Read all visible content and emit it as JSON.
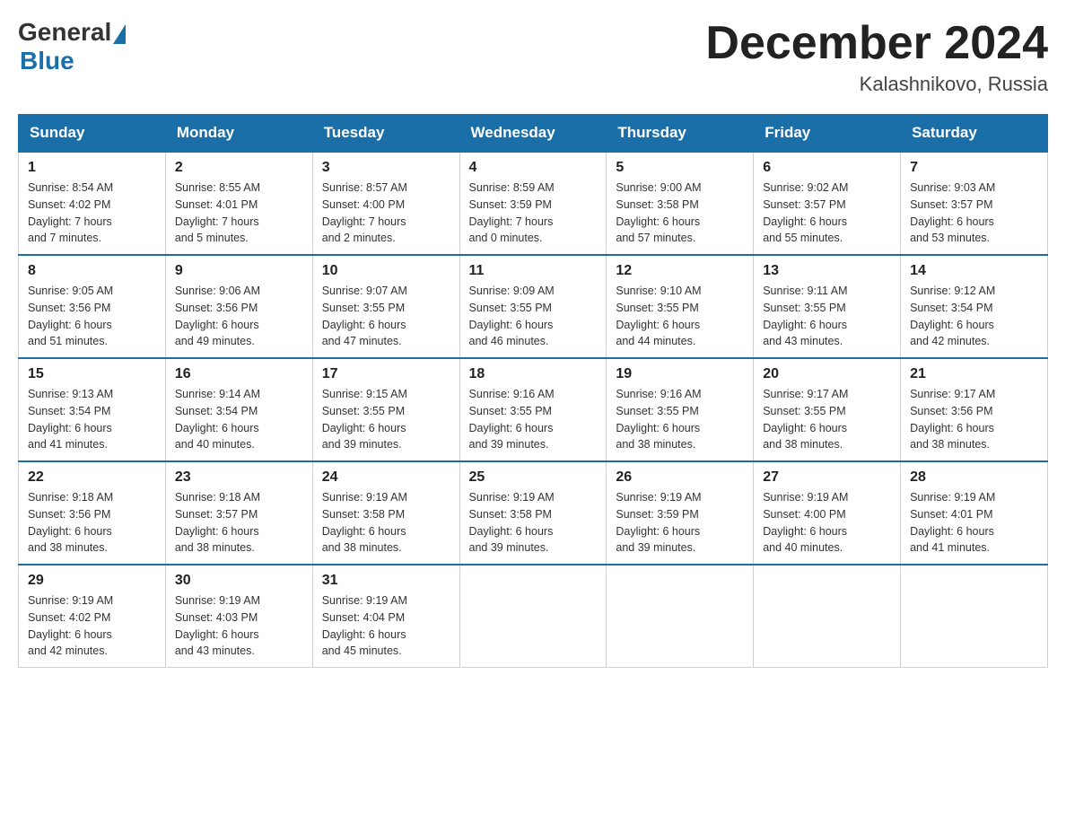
{
  "logo": {
    "general": "General",
    "triangle": "",
    "blue": "Blue"
  },
  "title": "December 2024",
  "location": "Kalashnikovo, Russia",
  "headers": [
    "Sunday",
    "Monday",
    "Tuesday",
    "Wednesday",
    "Thursday",
    "Friday",
    "Saturday"
  ],
  "weeks": [
    [
      {
        "day": "1",
        "info": "Sunrise: 8:54 AM\nSunset: 4:02 PM\nDaylight: 7 hours\nand 7 minutes."
      },
      {
        "day": "2",
        "info": "Sunrise: 8:55 AM\nSunset: 4:01 PM\nDaylight: 7 hours\nand 5 minutes."
      },
      {
        "day": "3",
        "info": "Sunrise: 8:57 AM\nSunset: 4:00 PM\nDaylight: 7 hours\nand 2 minutes."
      },
      {
        "day": "4",
        "info": "Sunrise: 8:59 AM\nSunset: 3:59 PM\nDaylight: 7 hours\nand 0 minutes."
      },
      {
        "day": "5",
        "info": "Sunrise: 9:00 AM\nSunset: 3:58 PM\nDaylight: 6 hours\nand 57 minutes."
      },
      {
        "day": "6",
        "info": "Sunrise: 9:02 AM\nSunset: 3:57 PM\nDaylight: 6 hours\nand 55 minutes."
      },
      {
        "day": "7",
        "info": "Sunrise: 9:03 AM\nSunset: 3:57 PM\nDaylight: 6 hours\nand 53 minutes."
      }
    ],
    [
      {
        "day": "8",
        "info": "Sunrise: 9:05 AM\nSunset: 3:56 PM\nDaylight: 6 hours\nand 51 minutes."
      },
      {
        "day": "9",
        "info": "Sunrise: 9:06 AM\nSunset: 3:56 PM\nDaylight: 6 hours\nand 49 minutes."
      },
      {
        "day": "10",
        "info": "Sunrise: 9:07 AM\nSunset: 3:55 PM\nDaylight: 6 hours\nand 47 minutes."
      },
      {
        "day": "11",
        "info": "Sunrise: 9:09 AM\nSunset: 3:55 PM\nDaylight: 6 hours\nand 46 minutes."
      },
      {
        "day": "12",
        "info": "Sunrise: 9:10 AM\nSunset: 3:55 PM\nDaylight: 6 hours\nand 44 minutes."
      },
      {
        "day": "13",
        "info": "Sunrise: 9:11 AM\nSunset: 3:55 PM\nDaylight: 6 hours\nand 43 minutes."
      },
      {
        "day": "14",
        "info": "Sunrise: 9:12 AM\nSunset: 3:54 PM\nDaylight: 6 hours\nand 42 minutes."
      }
    ],
    [
      {
        "day": "15",
        "info": "Sunrise: 9:13 AM\nSunset: 3:54 PM\nDaylight: 6 hours\nand 41 minutes."
      },
      {
        "day": "16",
        "info": "Sunrise: 9:14 AM\nSunset: 3:54 PM\nDaylight: 6 hours\nand 40 minutes."
      },
      {
        "day": "17",
        "info": "Sunrise: 9:15 AM\nSunset: 3:55 PM\nDaylight: 6 hours\nand 39 minutes."
      },
      {
        "day": "18",
        "info": "Sunrise: 9:16 AM\nSunset: 3:55 PM\nDaylight: 6 hours\nand 39 minutes."
      },
      {
        "day": "19",
        "info": "Sunrise: 9:16 AM\nSunset: 3:55 PM\nDaylight: 6 hours\nand 38 minutes."
      },
      {
        "day": "20",
        "info": "Sunrise: 9:17 AM\nSunset: 3:55 PM\nDaylight: 6 hours\nand 38 minutes."
      },
      {
        "day": "21",
        "info": "Sunrise: 9:17 AM\nSunset: 3:56 PM\nDaylight: 6 hours\nand 38 minutes."
      }
    ],
    [
      {
        "day": "22",
        "info": "Sunrise: 9:18 AM\nSunset: 3:56 PM\nDaylight: 6 hours\nand 38 minutes."
      },
      {
        "day": "23",
        "info": "Sunrise: 9:18 AM\nSunset: 3:57 PM\nDaylight: 6 hours\nand 38 minutes."
      },
      {
        "day": "24",
        "info": "Sunrise: 9:19 AM\nSunset: 3:58 PM\nDaylight: 6 hours\nand 38 minutes."
      },
      {
        "day": "25",
        "info": "Sunrise: 9:19 AM\nSunset: 3:58 PM\nDaylight: 6 hours\nand 39 minutes."
      },
      {
        "day": "26",
        "info": "Sunrise: 9:19 AM\nSunset: 3:59 PM\nDaylight: 6 hours\nand 39 minutes."
      },
      {
        "day": "27",
        "info": "Sunrise: 9:19 AM\nSunset: 4:00 PM\nDaylight: 6 hours\nand 40 minutes."
      },
      {
        "day": "28",
        "info": "Sunrise: 9:19 AM\nSunset: 4:01 PM\nDaylight: 6 hours\nand 41 minutes."
      }
    ],
    [
      {
        "day": "29",
        "info": "Sunrise: 9:19 AM\nSunset: 4:02 PM\nDaylight: 6 hours\nand 42 minutes."
      },
      {
        "day": "30",
        "info": "Sunrise: 9:19 AM\nSunset: 4:03 PM\nDaylight: 6 hours\nand 43 minutes."
      },
      {
        "day": "31",
        "info": "Sunrise: 9:19 AM\nSunset: 4:04 PM\nDaylight: 6 hours\nand 45 minutes."
      },
      {
        "day": "",
        "info": ""
      },
      {
        "day": "",
        "info": ""
      },
      {
        "day": "",
        "info": ""
      },
      {
        "day": "",
        "info": ""
      }
    ]
  ]
}
